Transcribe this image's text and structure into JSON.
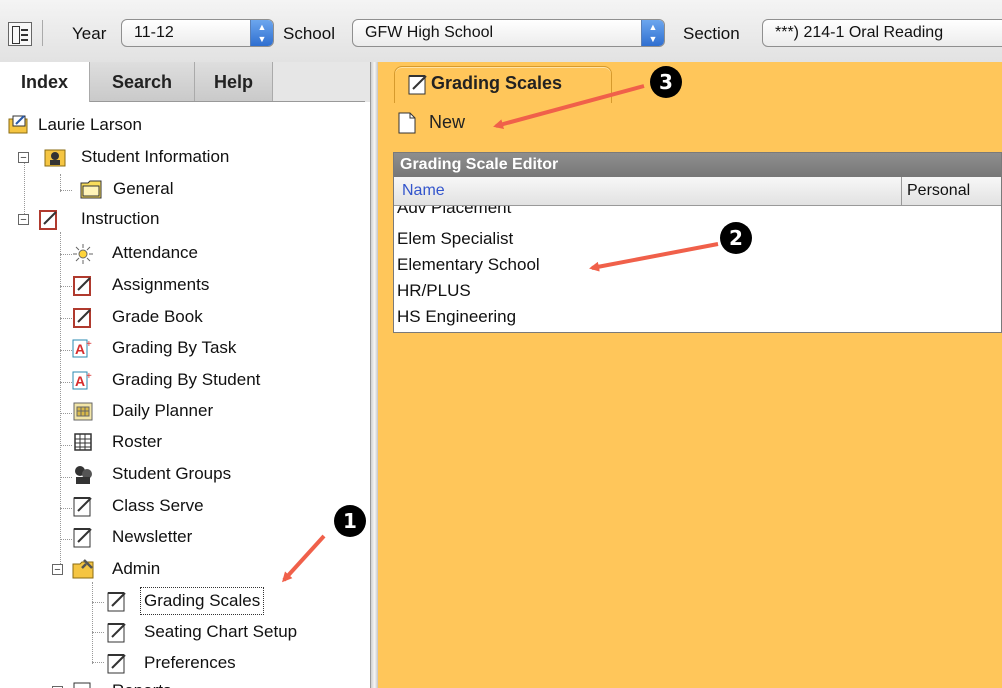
{
  "toolbar": {
    "year_label": "Year",
    "year_value": "11-12",
    "school_label": "School",
    "school_value": "GFW High School",
    "section_label": "Section",
    "section_value": "***) 214-1 Oral Reading"
  },
  "left_tabs": [
    "Index",
    "Search",
    "Help"
  ],
  "tree": {
    "user": "Laurie Larson",
    "student_information": "Student Information",
    "general": "General",
    "instruction": "Instruction",
    "instruction_items": [
      "Attendance",
      "Assignments",
      "Grade Book",
      "Grading By Task",
      "Grading By Student",
      "Daily Planner",
      "Roster",
      "Student Groups",
      "Class Serve",
      "Newsletter"
    ],
    "admin": "Admin",
    "admin_items": [
      "Grading Scales",
      "Seating Chart Setup",
      "Preferences"
    ],
    "next_folder": "Reports"
  },
  "right": {
    "tab_title": "Grading Scales",
    "new_label": "New",
    "editor_title": "Grading Scale Editor",
    "columns": [
      "Name",
      "Personal"
    ],
    "rows": [
      "Adv Placement",
      "Elem Specialist",
      "Elementary School",
      "HR/PLUS",
      "HS Engineering"
    ]
  },
  "annotations": {
    "badge_1": "1",
    "badge_2": "2",
    "badge_3": "3",
    "arrow_color": "#f0604a"
  },
  "colors": {
    "panel_orange": "#ffc65a",
    "header_gray": "#7f7f7f",
    "link_blue": "#3355cc",
    "stepper_blue": "#2f6fd0"
  }
}
